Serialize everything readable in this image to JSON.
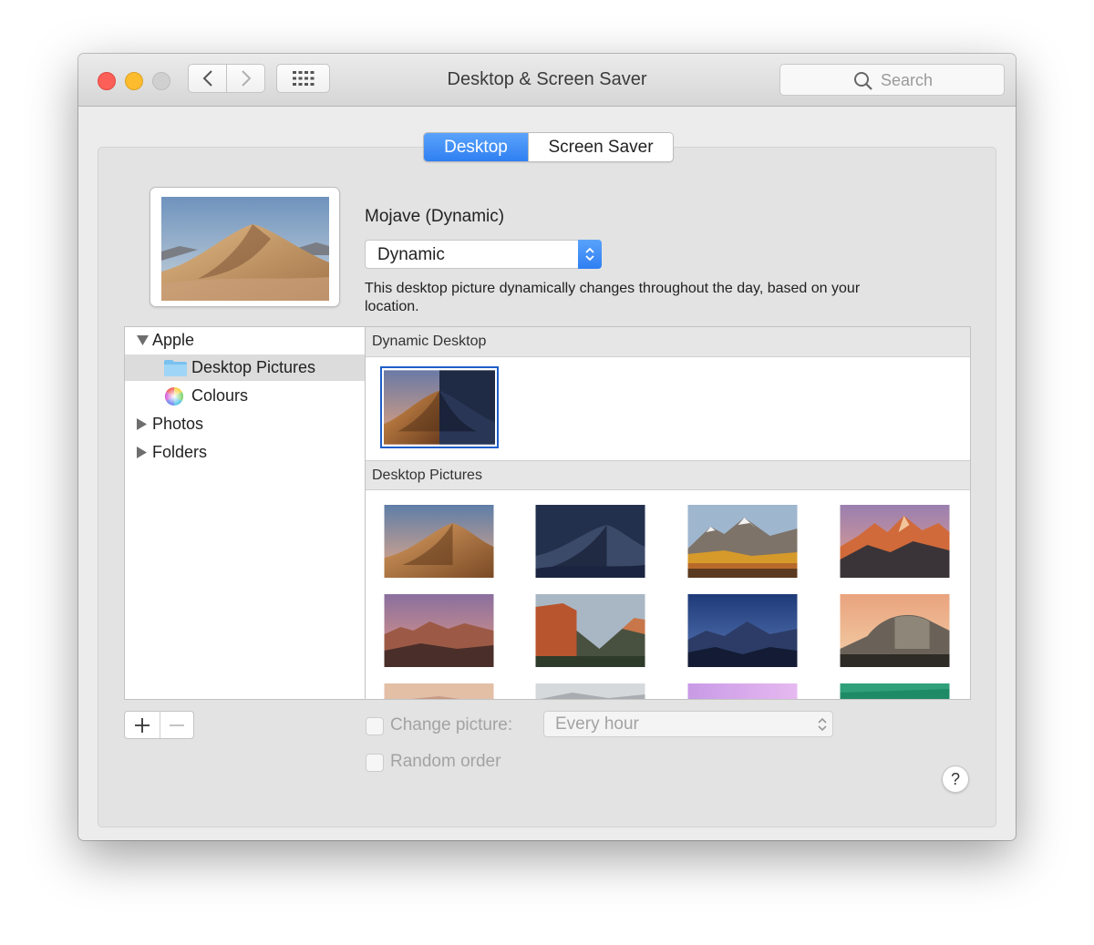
{
  "window": {
    "title": "Desktop & Screen Saver",
    "search_placeholder": "Search"
  },
  "tabs": [
    {
      "label": "Desktop",
      "active": true
    },
    {
      "label": "Screen Saver",
      "active": false
    }
  ],
  "current": {
    "name": "Mojave (Dynamic)",
    "mode": "Dynamic",
    "description": "This desktop picture dynamically changes throughout the day, based on your location."
  },
  "sidebar": {
    "items": [
      {
        "label": "Apple",
        "expanded": true,
        "icon": "disclosure-open-icon"
      },
      {
        "label": "Desktop Pictures",
        "selected": true,
        "icon": "folder-icon"
      },
      {
        "label": "Colours",
        "icon": "color-wheel-icon"
      },
      {
        "label": "Photos",
        "expanded": false,
        "icon": "disclosure-closed-icon"
      },
      {
        "label": "Folders",
        "expanded": false,
        "icon": "disclosure-closed-icon"
      }
    ]
  },
  "content": {
    "sections": [
      {
        "title": "Dynamic Desktop"
      },
      {
        "title": "Desktop Pictures"
      }
    ]
  },
  "controls": {
    "plus": "+",
    "minus": "−",
    "change_picture_label": "Change picture:",
    "change_picture_checked": false,
    "interval": "Every hour",
    "random_order_label": "Random order",
    "random_order_checked": false,
    "help": "?"
  },
  "colors": {
    "accent": "#2f7ff2",
    "selection_border": "#1e5ec9"
  }
}
